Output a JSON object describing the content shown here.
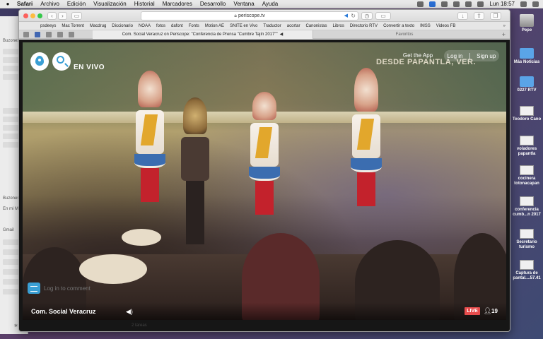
{
  "menubar": {
    "app": "Safari",
    "items": [
      "Archivo",
      "Edición",
      "Visualización",
      "Historial",
      "Marcadores",
      "Desarrollo",
      "Ventana",
      "Ayuda"
    ],
    "clock": "Lun 18:57"
  },
  "browser": {
    "address": "periscope.tv",
    "favorites": [
      "psdeeys",
      "Mac Torrent",
      "Macdrug",
      "Diccionario",
      "NOAA",
      "fotos",
      "dafont",
      "Fonts",
      "Motion AE",
      "SNITE en Vivo",
      "Traductor",
      "acortar",
      "Canonistas",
      "Libros",
      "Directorio RTV",
      "Convertir a texto",
      "IMSS",
      "Videos FB"
    ],
    "active_tab": "Com. Social Veracruz on Periscope: \"Conferencia de Prensa \"Cumbre Tajín 2017\"\"",
    "other_tab": "Favoritos"
  },
  "periscope": {
    "live_label": "EN VIVO",
    "overlay_title": "DESDE PAPANTLA, VER.",
    "get_app": "Get the App",
    "log_in": "Log in",
    "sign_up": "Sign up",
    "comment_placeholder": "Log in to comment",
    "broadcaster": "Com. Social Veracruz",
    "live_badge": "LIVE",
    "viewers": "19"
  },
  "desktop": {
    "items": [
      "Pepe",
      "Más Noticias",
      "0227 RTV",
      "Teodoro Cano",
      "voladores papantla",
      "cocinera totonacapan",
      "conferencia cumb...n 2017",
      "Secretario turismo",
      "Captura de pantal....57.41"
    ]
  },
  "mail": {
    "sections": [
      "Buzones",
      "Buzones",
      "En mi M",
      "Gmail"
    ],
    "status": "2 tareas"
  }
}
